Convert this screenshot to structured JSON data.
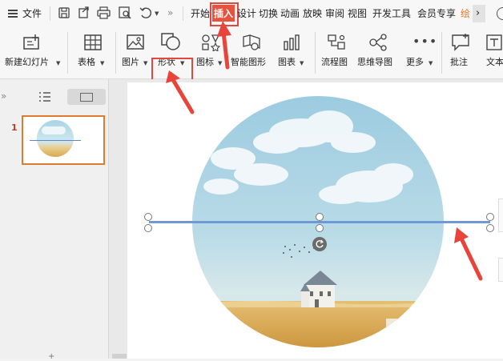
{
  "menu": {
    "hamburger_label": "文件",
    "tabs": [
      "开始",
      "插入",
      "设计",
      "切换",
      "动画",
      "放映",
      "审阅",
      "视图",
      "开发工具",
      "会员专享",
      "绘"
    ],
    "active_tab": "插入"
  },
  "ribbon": {
    "new_slide": "新建幻灯片",
    "table": "表格",
    "picture": "图片",
    "shape": "形状",
    "icon": "图标",
    "smart_art": "智能图形",
    "chart": "图表",
    "flowchart": "流程图",
    "mindmap": "思维导图",
    "more": "更多",
    "comment": "批注",
    "textbox": "文本"
  },
  "thumbnails": [
    {
      "number": "1"
    }
  ],
  "colors": {
    "accent_red": "#e2463e",
    "active_tab_bg": "#e8533f",
    "line_blue": "#6f98d6",
    "thumb_border": "#e07a2f",
    "sky": "#a9d4e4",
    "wheat": "#d9a84d"
  }
}
